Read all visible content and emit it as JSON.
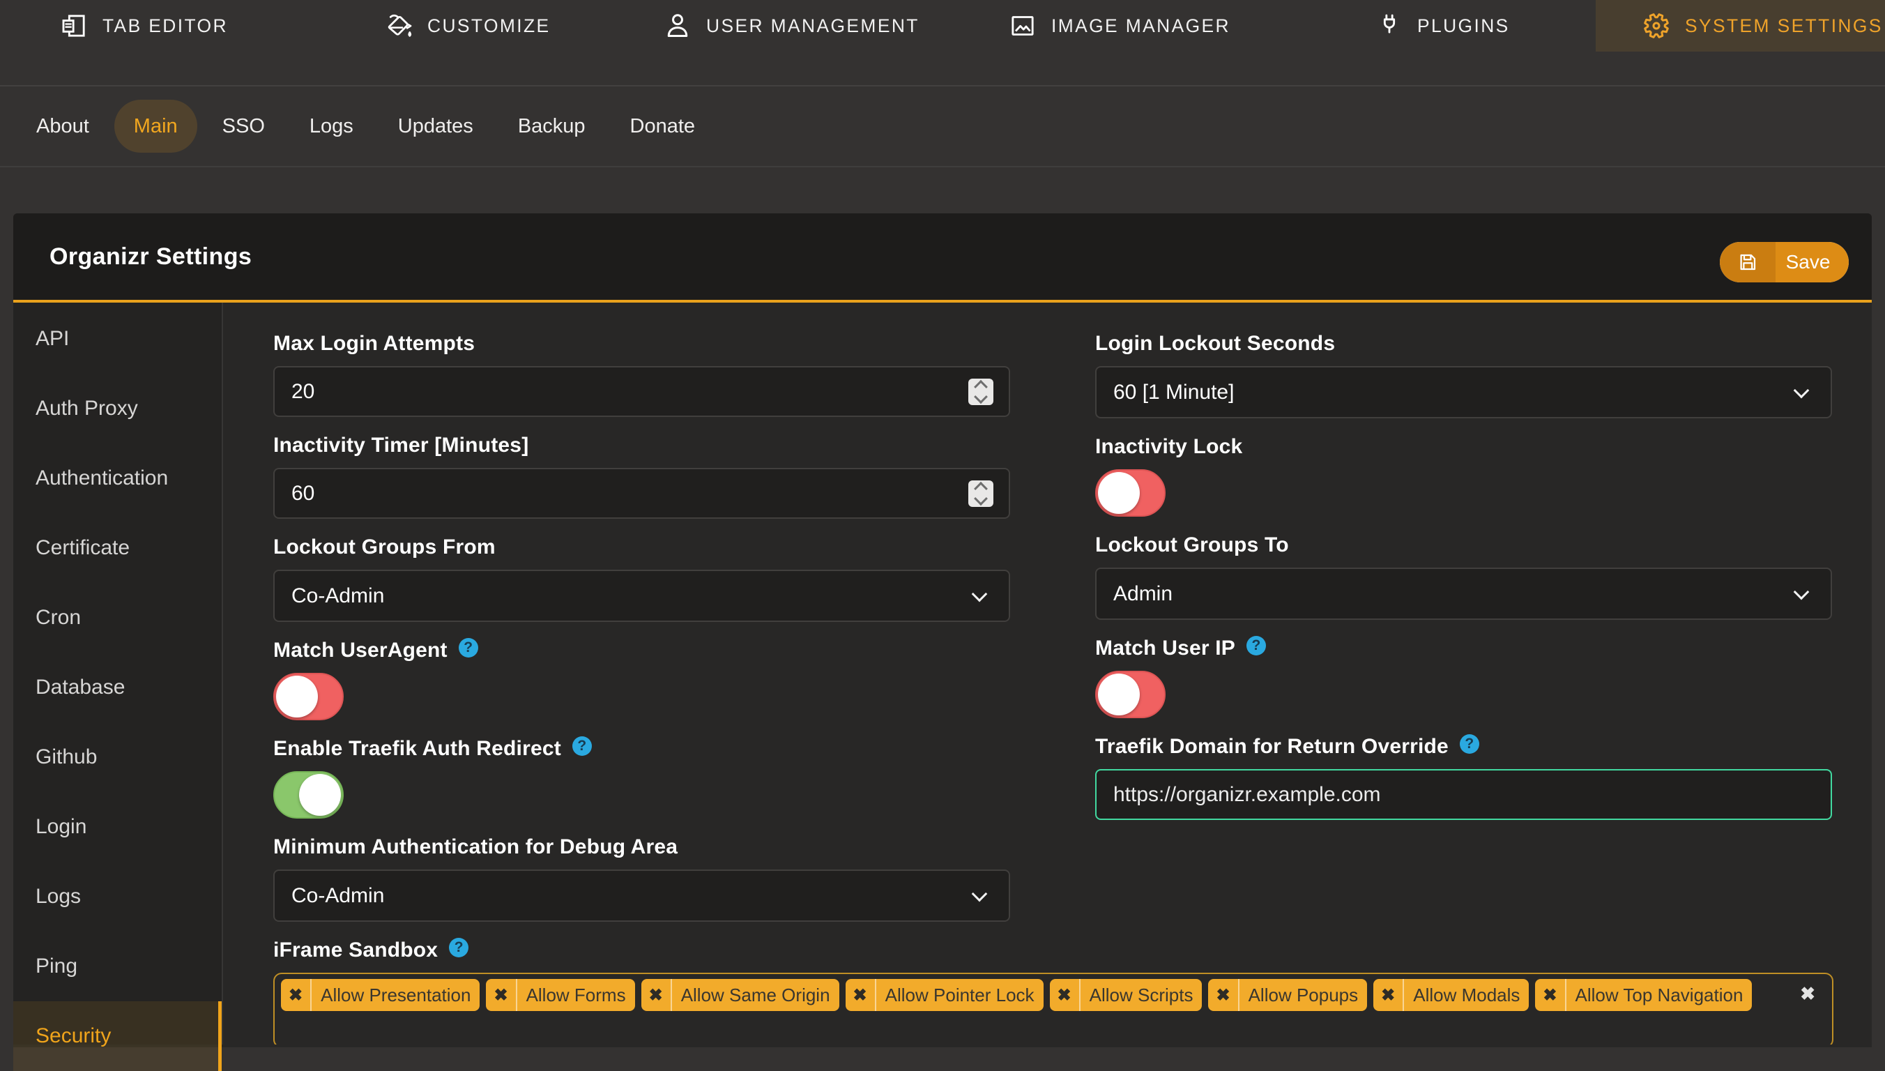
{
  "colors": {
    "accent_gold": "#efa32a",
    "save_orange": "#dd8c15",
    "toggle_off_red": "#f06161",
    "toggle_on_green": "#8ac76b",
    "valid_input_green": "#42d9a0",
    "help_blue": "#2aa9e0",
    "chip_amber": "#f2ab2b"
  },
  "topnav": {
    "items": [
      {
        "label": "TAB EDITOR",
        "icon": "tab-editor-icon",
        "active": false
      },
      {
        "label": "CUSTOMIZE",
        "icon": "customize-icon",
        "active": false
      },
      {
        "label": "USER MANAGEMENT",
        "icon": "user-management-icon",
        "active": false
      },
      {
        "label": "IMAGE MANAGER",
        "icon": "image-manager-icon",
        "active": false
      },
      {
        "label": "PLUGINS",
        "icon": "plugins-icon",
        "active": false
      },
      {
        "label": "SYSTEM SETTINGS",
        "icon": "gear-icon",
        "active": true
      }
    ]
  },
  "tabs": {
    "active": "Main",
    "items": [
      {
        "label": "About"
      },
      {
        "label": "Main"
      },
      {
        "label": "SSO"
      },
      {
        "label": "Logs"
      },
      {
        "label": "Updates"
      },
      {
        "label": "Backup"
      },
      {
        "label": "Donate"
      }
    ]
  },
  "panel": {
    "title": "Organizr Settings",
    "save_button": "Save"
  },
  "sidebar": {
    "active": "Security",
    "items": [
      {
        "label": "API"
      },
      {
        "label": "Auth Proxy"
      },
      {
        "label": "Authentication"
      },
      {
        "label": "Certificate"
      },
      {
        "label": "Cron"
      },
      {
        "label": "Database"
      },
      {
        "label": "Github"
      },
      {
        "label": "Login"
      },
      {
        "label": "Logs"
      },
      {
        "label": "Ping"
      },
      {
        "label": "Security"
      }
    ]
  },
  "form": {
    "max_login_attempts": {
      "label": "Max Login Attempts",
      "value": "20",
      "type": "number"
    },
    "inactivity_timer": {
      "label": "Inactivity Timer [Minutes]",
      "value": "60",
      "type": "number"
    },
    "lockout_groups_from": {
      "label": "Lockout Groups From",
      "value": "Co-Admin",
      "type": "select"
    },
    "match_useragent": {
      "label": "Match UserAgent",
      "value": "off",
      "type": "toggle",
      "has_help": true
    },
    "enable_traefik_auth_redirect": {
      "label": "Enable Traefik Auth Redirect",
      "value": "on",
      "type": "toggle",
      "has_help": true
    },
    "min_auth_debug": {
      "label": "Minimum Authentication for Debug Area",
      "value": "Co-Admin",
      "type": "select"
    },
    "iframe_sandbox": {
      "label": "iFrame Sandbox",
      "type": "tags",
      "has_help": true,
      "chips": [
        "Allow Presentation",
        "Allow Forms",
        "Allow Same Origin",
        "Allow Pointer Lock",
        "Allow Scripts",
        "Allow Popups",
        "Allow Modals",
        "Allow Top Navigation"
      ]
    },
    "login_lockout_seconds": {
      "label": "Login Lockout Seconds",
      "value": "60 [1 Minute]",
      "type": "select"
    },
    "inactivity_lock": {
      "label": "Inactivity Lock",
      "value": "off",
      "type": "toggle"
    },
    "lockout_groups_to": {
      "label": "Lockout Groups To",
      "value": "Admin",
      "type": "select"
    },
    "match_user_ip": {
      "label": "Match User IP",
      "value": "off",
      "type": "toggle",
      "has_help": true
    },
    "traefik_domain": {
      "label": "Traefik Domain for Return Override",
      "value": "https://organizr.example.com",
      "type": "text",
      "has_help": true
    }
  }
}
